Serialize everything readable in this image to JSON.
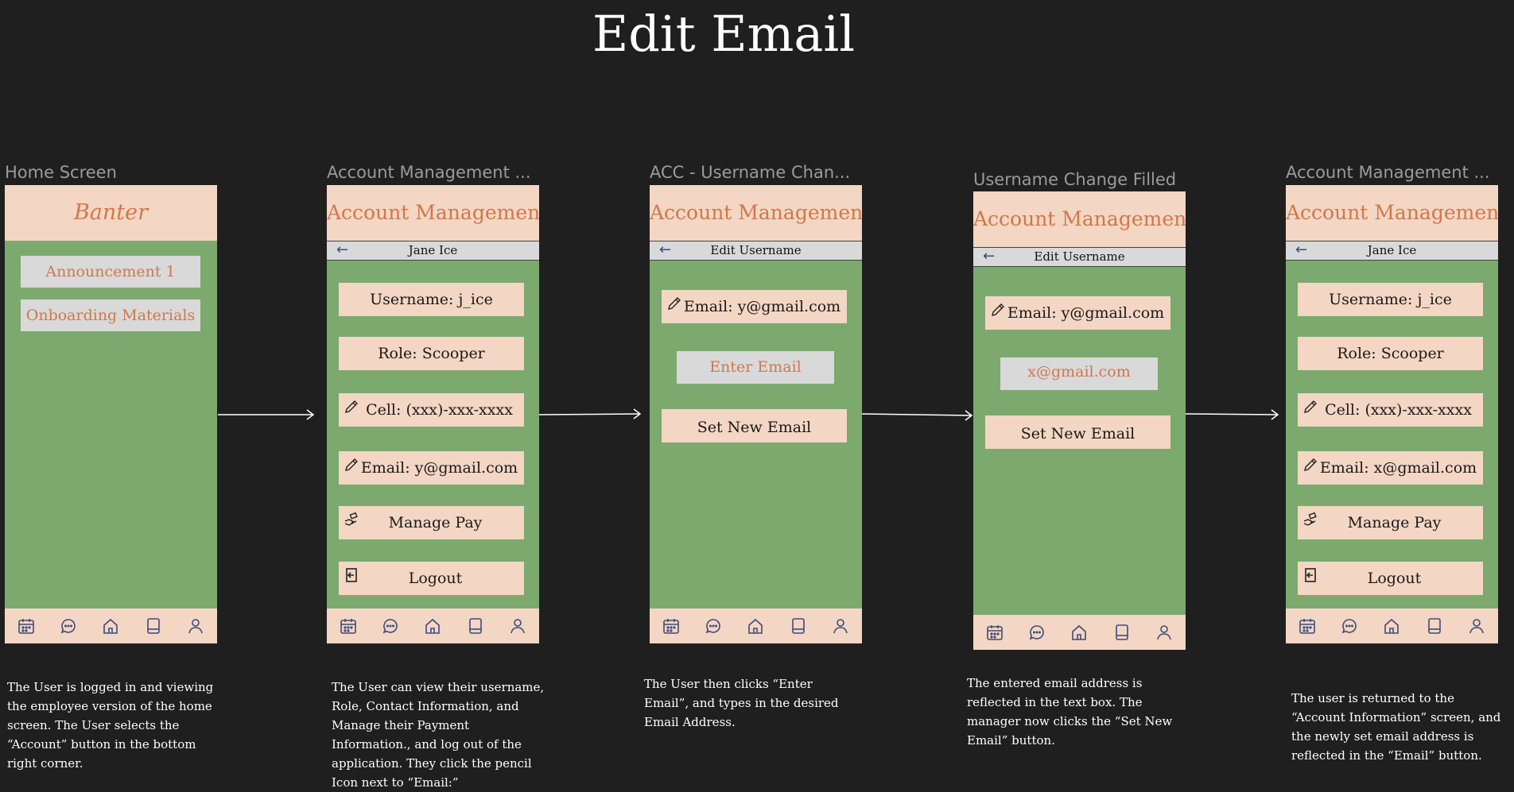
{
  "title": "Edit Email",
  "frames": {
    "f1": {
      "label": "Home Screen",
      "header": "Banter",
      "items": [
        "Announcement 1",
        "Onboarding Materials"
      ],
      "description": "The User is logged in and viewing the employee version of the home screen. The User selects the “Account” button in the bottom right corner."
    },
    "f2": {
      "label": "Account Management ...",
      "header": "Account Management",
      "subheader": "Jane Ice",
      "buttons": [
        "Username: j_ice",
        "Role: Scooper",
        "Cell: (xxx)-xxx-xxxx",
        "Email: y@gmail.com",
        "Manage Pay",
        "Logout"
      ],
      "description": "The User  can view their username, Role, Contact Information, and Manage their Payment Information., and log out of the application. They click the pencil Icon next to “Email:”"
    },
    "f3": {
      "label": "ACC - Username Chan...",
      "header": "Account Management",
      "subheader": "Edit Username",
      "email_button": "Email: y@gmail.com",
      "input_placeholder": "Enter Email",
      "set_button": "Set New Email",
      "description": "The User then clicks “Enter Email”, and types in the desired Email Address."
    },
    "f4": {
      "label": "Username Change Filled",
      "header": "Account Management",
      "subheader": "Edit Username",
      "email_button": "Email: y@gmail.com",
      "input_value": "x@gmail.com",
      "set_button": "Set New Email",
      "description": "The entered email address is reflected in the text box.  The manager now clicks the “Set New Email” button."
    },
    "f5": {
      "label": "Account Management ...",
      "header": "Account Management",
      "subheader": "Jane Ice",
      "buttons": [
        "Username: j_ice",
        "Role: Scooper",
        "Cell: (xxx)-xxx-xxxx",
        "Email: x@gmail.com",
        "Manage Pay",
        "Logout"
      ],
      "description": "The user is returned to the “Account Information” screen, and the newly set email address is reflected in the “Email” button."
    }
  },
  "icons": {
    "nav": [
      "calendar-icon",
      "chat-icon",
      "home-icon",
      "book-icon",
      "account-icon"
    ],
    "edit": "pencil-icon",
    "pay": "hand-money-icon",
    "logout": "logout-icon",
    "back": "back-arrow-icon"
  },
  "colors": {
    "background": "#1f1f1f",
    "phone_body": "#7ca96e",
    "peach": "#f3d6c4",
    "accent_text": "#d0784a",
    "grey_box": "#d9d9d9",
    "icon": "#3f4b7a"
  }
}
